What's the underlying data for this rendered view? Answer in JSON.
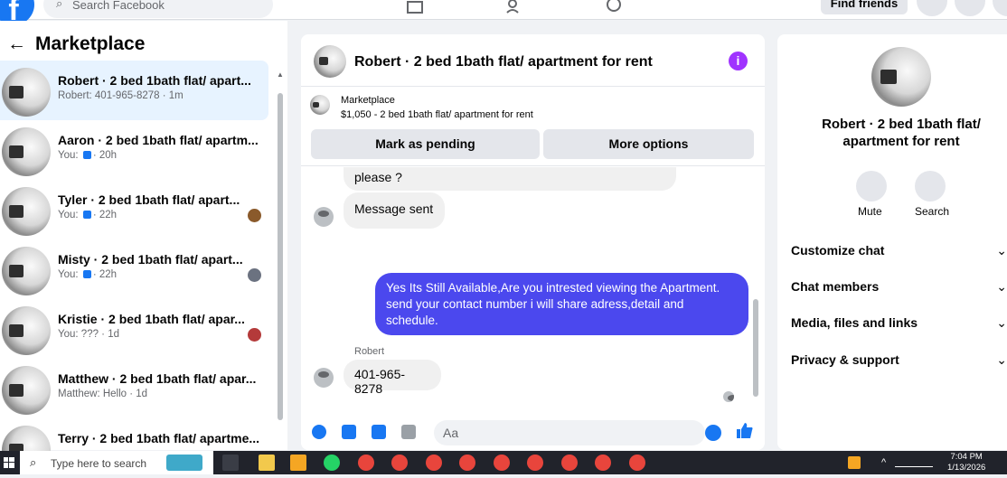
{
  "topbar": {
    "search_placeholder": "Search Facebook",
    "find_friends": "Find friends"
  },
  "sidebar": {
    "back_arrow": "←",
    "title": "Marketplace",
    "conversations": [
      {
        "title": "Robert · 2 bed 1bath flat/ apart...",
        "subtitle": "Robert: 401-965-8278 · 1m",
        "selected": true
      },
      {
        "title": "Aaron · 2 bed 1bath flat/ apartm...",
        "subtitle_prefix": "You:",
        "subtitle_suffix": "· 20h"
      },
      {
        "title": "Tyler · 2 bed 1bath flat/ apart...",
        "subtitle_prefix": "You:",
        "subtitle_suffix": "· 22h"
      },
      {
        "title": "Misty · 2 bed 1bath flat/ apart...",
        "subtitle_prefix": "You:",
        "subtitle_suffix": "· 22h"
      },
      {
        "title": "Kristie · 2 bed 1bath flat/ apar...",
        "subtitle": "You: ??? · 1d"
      },
      {
        "title": "Matthew · 2 bed 1bath flat/ apar...",
        "subtitle": "Matthew: Hello · 1d"
      },
      {
        "title": "Terry · 2 bed 1bath flat/ apartme...",
        "subtitle": ""
      }
    ]
  },
  "chat": {
    "header_title": "Robert · 2 bed 1bath flat/ apartment for rent",
    "info_icon": "i",
    "marketplace_label": "Marketplace",
    "listing": "$1,050 - 2 bed 1bath flat/ apartment for rent",
    "mark_pending": "Mark as pending",
    "more_options": "More options",
    "messages": {
      "partial": "please ?",
      "sent_notice": "Message sent",
      "outgoing": "Yes Its Still Available,Are you intrested viewing the Apartment. send your contact number i will share adress,detail and schedule.",
      "sender_name": "Robert",
      "incoming": "401-965-8278"
    },
    "composer_placeholder": "Aa"
  },
  "details": {
    "title": "Robert · 2 bed 1bath flat/ apartment for rent",
    "mute_label": "Mute",
    "search_label": "Search",
    "sections": [
      "Customize chat",
      "Chat members",
      "Media, files and links",
      "Privacy & support"
    ],
    "chevron": "⌄"
  },
  "taskbar": {
    "search_placeholder": "Type here to search",
    "time": "7:04 PM",
    "date": "1/13/2026"
  },
  "colors": {
    "brand": "#1877f2",
    "outgoing_bubble": "#4b48ee",
    "selected_row": "#e7f3ff",
    "info_badge": "#a033ff"
  }
}
